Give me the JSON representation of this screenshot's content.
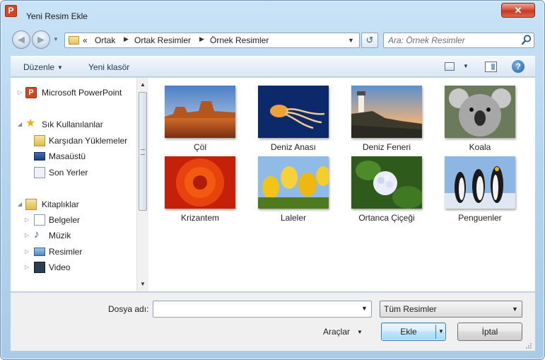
{
  "window": {
    "title": "Yeni Resim Ekle",
    "app_icon_letter": "P",
    "close_glyph": "✕"
  },
  "nav": {
    "back_glyph": "◀",
    "forward_glyph": "▶",
    "breadcrumb_prefix": "«",
    "breadcrumbs": [
      "Ortak",
      "Ortak Resimler",
      "Örnek Resimler"
    ],
    "refresh_glyph": "↺",
    "search_placeholder": "Ara: Örnek Resimler"
  },
  "toolbar": {
    "organize": "Düzenle",
    "new_folder": "Yeni klasör",
    "help_glyph": "?"
  },
  "sidebar": {
    "items": [
      {
        "label": "Microsoft PowerPoint",
        "icon": "powerpoint-icon"
      },
      {
        "label": "Sık Kullanılanlar",
        "icon": "star-icon"
      },
      {
        "label": "Karşıdan Yüklemeler",
        "icon": "downloads-icon"
      },
      {
        "label": "Masaüstü",
        "icon": "desktop-icon"
      },
      {
        "label": "Son Yerler",
        "icon": "recent-places-icon"
      },
      {
        "label": "Kitaplıklar",
        "icon": "libraries-icon"
      },
      {
        "label": "Belgeler",
        "icon": "documents-icon"
      },
      {
        "label": "Müzik",
        "icon": "music-icon"
      },
      {
        "label": "Resimler",
        "icon": "pictures-icon"
      },
      {
        "label": "Video",
        "icon": "video-icon"
      }
    ]
  },
  "files": [
    {
      "name": "Çöl",
      "icon": "desert-thumbnail"
    },
    {
      "name": "Deniz Anası",
      "icon": "jellyfish-thumbnail"
    },
    {
      "name": "Deniz Feneri",
      "icon": "lighthouse-thumbnail"
    },
    {
      "name": "Koala",
      "icon": "koala-thumbnail"
    },
    {
      "name": "Krizantem",
      "icon": "chrysanthemum-thumbnail"
    },
    {
      "name": "Laleler",
      "icon": "tulips-thumbnail"
    },
    {
      "name": "Ortanca Çiçeği",
      "icon": "hydrangeas-thumbnail"
    },
    {
      "name": "Penguenler",
      "icon": "penguins-thumbnail"
    }
  ],
  "bottom": {
    "filename_label": "Dosya adı:",
    "filename_value": "",
    "filter_value": "Tüm Resimler",
    "tools": "Araçlar",
    "insert": "Ekle",
    "cancel": "İptal"
  },
  "colors": {
    "accent": "#3c7fb1",
    "frame": "#b7d6ef",
    "close": "#c23a21"
  }
}
